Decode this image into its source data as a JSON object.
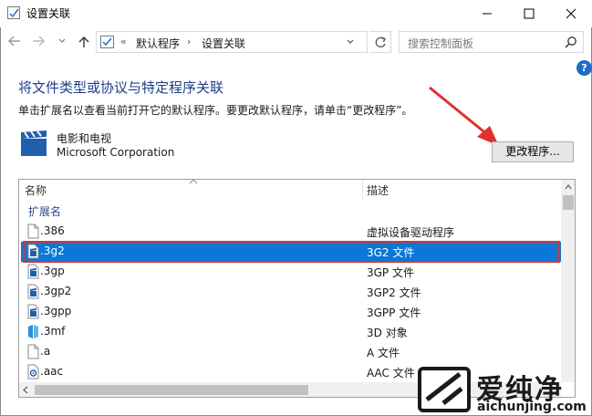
{
  "window": {
    "title": "设置关联",
    "minimize": "minimize",
    "maximize": "maximize",
    "close": "close"
  },
  "address": {
    "crumbs": [
      "默认程序",
      "设置关联"
    ],
    "overflow": "«",
    "separator": "›",
    "search_placeholder": "搜索控制面板"
  },
  "content": {
    "heading": "将文件类型或协议与特定程序关联",
    "description": "单击扩展名以查看当前打开它的默认程序。要更改默认程序，请单击“更改程序”。",
    "app_name": "电影和电视",
    "app_publisher": "Microsoft Corporation",
    "change_button": "更改程序...",
    "help": "?"
  },
  "list": {
    "columns": [
      "名称",
      "描述"
    ],
    "group": "扩展名",
    "selected_index": 1,
    "rows": [
      {
        "name": ".386",
        "desc": "虚拟设备驱动程序",
        "icon": "blank-file-icon"
      },
      {
        "name": ".3g2",
        "desc": "3G2 文件",
        "icon": "video-file-icon"
      },
      {
        "name": ".3gp",
        "desc": "3GP 文件",
        "icon": "video-file-icon"
      },
      {
        "name": ".3gp2",
        "desc": "3GP2 文件",
        "icon": "video-file-icon"
      },
      {
        "name": ".3gpp",
        "desc": "3GPP 文件",
        "icon": "video-file-icon"
      },
      {
        "name": ".3mf",
        "desc": "3D 对象",
        "icon": "3d-object-icon"
      },
      {
        "name": ".a",
        "desc": "A 文件",
        "icon": "blank-file-icon"
      },
      {
        "name": ".aac",
        "desc": "AAC 文件",
        "icon": "audio-file-icon"
      }
    ]
  },
  "watermark": {
    "brand": "爱纯净",
    "url": "aichunjing.com"
  },
  "colors": {
    "selection": "#0a78d7",
    "highlight_outline": "#e0302e",
    "heading": "#1e3e8a",
    "arrow": "#e0302e"
  }
}
